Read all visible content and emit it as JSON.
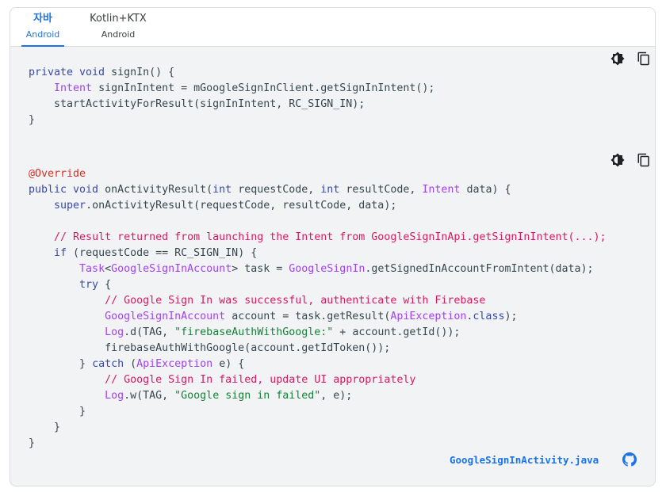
{
  "tabs": [
    {
      "label": "자바",
      "sub": "Android",
      "active": true
    },
    {
      "label": "Kotlin+KTX",
      "sub": "Android",
      "active": false
    }
  ],
  "toolbar": {
    "theme_icon": "brightness-icon",
    "copy_icon": "copy-icon"
  },
  "code1": [
    "private void signIn() {",
    "    Intent signInIntent = mGoogleSignInClient.getSignInIntent();",
    "    startActivityForResult(signInIntent, RC_SIGN_IN);",
    "}"
  ],
  "code2": [
    "@Override",
    "public void onActivityResult(int requestCode, int resultCode, Intent data) {",
    "    super.onActivityResult(requestCode, resultCode, data);",
    "",
    "    // Result returned from launching the Intent from GoogleSignInApi.getSignInIntent(...);",
    "    if (requestCode == RC_SIGN_IN) {",
    "        Task<GoogleSignInAccount> task = GoogleSignIn.getSignedInAccountFromIntent(data);",
    "        try {",
    "            // Google Sign In was successful, authenticate with Firebase",
    "            GoogleSignInAccount account = task.getResult(ApiException.class);",
    "            Log.d(TAG, \"firebaseAuthWithGoogle:\" + account.getId());",
    "            firebaseAuthWithGoogle(account.getIdToken());",
    "        } catch (ApiException e) {",
    "            // Google Sign In failed, update UI appropriately",
    "            Log.w(TAG, \"Google sign in failed\", e);",
    "        }",
    "    }",
    "}"
  ],
  "footer": {
    "filename": "GoogleSignInActivity.java",
    "icon": "github-icon"
  }
}
